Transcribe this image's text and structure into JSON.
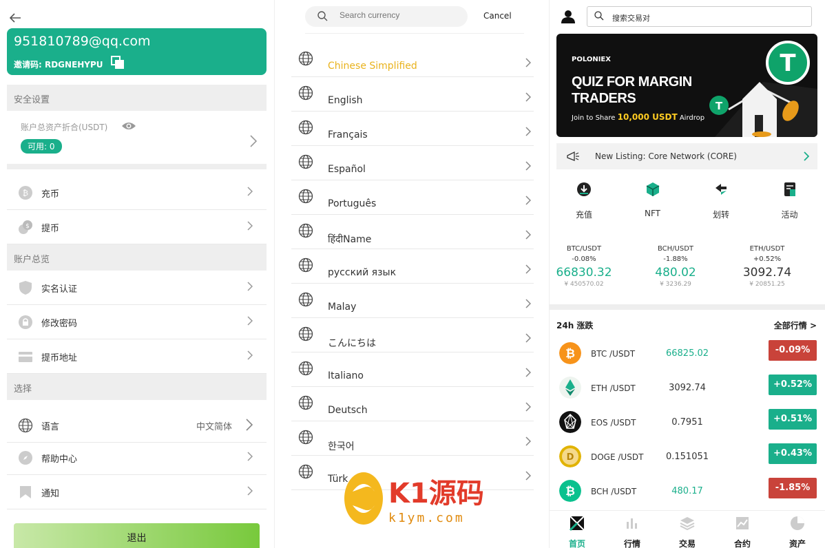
{
  "account": {
    "email": "951810789@qq.com",
    "invite_label": "邀请码: RDGNEHYPU",
    "section_security": "安全设置",
    "asset_label": "账户总资产折合(USDT)",
    "available_label": "可用: 0",
    "deposit": "充币",
    "withdraw": "提币",
    "section_overview": "账户总览",
    "verify": "实名认证",
    "change_password": "修改密码",
    "withdraw_address": "提币地址",
    "section_select": "选择",
    "language": "语言",
    "language_value": "中文简体",
    "help": "帮助中心",
    "notice": "通知",
    "logout": "退出"
  },
  "language_picker": {
    "search_placeholder": "Search currency",
    "cancel": "Cancel",
    "languages": [
      {
        "name": "Chinese Simplified",
        "active": true
      },
      {
        "name": "English"
      },
      {
        "name": "Français"
      },
      {
        "name": "Español"
      },
      {
        "name": "Português"
      },
      {
        "name": "हिंदीName"
      },
      {
        "name": "русский язык"
      },
      {
        "name": "Malay"
      },
      {
        "name": "こんにちは"
      },
      {
        "name": "Italiano"
      },
      {
        "name": "Deutsch"
      },
      {
        "name": "한국어"
      },
      {
        "name": "Türk"
      }
    ]
  },
  "home": {
    "search_placeholder": "搜索交易对",
    "banner": {
      "brand": "POLONIEX",
      "headline": "QUIZ FOR MARGIN TRADERS",
      "sub_prefix": "Join to Share",
      "sub_amount": "10,000 USDT",
      "sub_suffix": "Airdrop"
    },
    "news": "New Listing: Core Network (CORE)",
    "quick_actions": [
      {
        "label": "充值",
        "icon": "deposit-icon"
      },
      {
        "label": "NFT",
        "icon": "nft-cube-icon"
      },
      {
        "label": "划转",
        "icon": "transfer-icon"
      },
      {
        "label": "活动",
        "icon": "activity-icon"
      }
    ],
    "tickers": [
      {
        "pair": "BTC/USDT",
        "change": "-0.08%",
        "price": "66830.32",
        "cny": "¥ 450570.02"
      },
      {
        "pair": "BCH/USDT",
        "change": "-1.88%",
        "price": "480.02",
        "cny": "¥ 3236.29"
      },
      {
        "pair": "ETH/USDT",
        "change": "+0.52%",
        "price": "3092.74",
        "cny": "¥ 20851.25"
      }
    ],
    "market_title": "24h 涨跌",
    "market_all": "全部行情 >",
    "markets": [
      {
        "pair": "BTC /USDT",
        "price": "66825.02",
        "change": "-0.09%",
        "up": false
      },
      {
        "pair": "ETH /USDT",
        "price": "3092.74",
        "change": "+0.52%",
        "up": true
      },
      {
        "pair": "EOS /USDT",
        "price": "0.7951",
        "change": "+0.51%",
        "up": true
      },
      {
        "pair": "DOGE /USDT",
        "price": "0.151051",
        "change": "+0.43%",
        "up": true
      },
      {
        "pair": "BCH /USDT",
        "price": "480.17",
        "change": "-1.85%",
        "up": false
      }
    ],
    "tabs": [
      {
        "label": "首页",
        "active": true
      },
      {
        "label": "行情"
      },
      {
        "label": "交易"
      },
      {
        "label": "合约"
      },
      {
        "label": "资产"
      }
    ]
  },
  "watermark": {
    "brand": "K1源码",
    "url": "k1ym.com"
  },
  "colors": {
    "accent": "#1aaf8b",
    "up": "#1aaf8b",
    "down": "#c9433a",
    "active_language": "#e9b21c"
  }
}
